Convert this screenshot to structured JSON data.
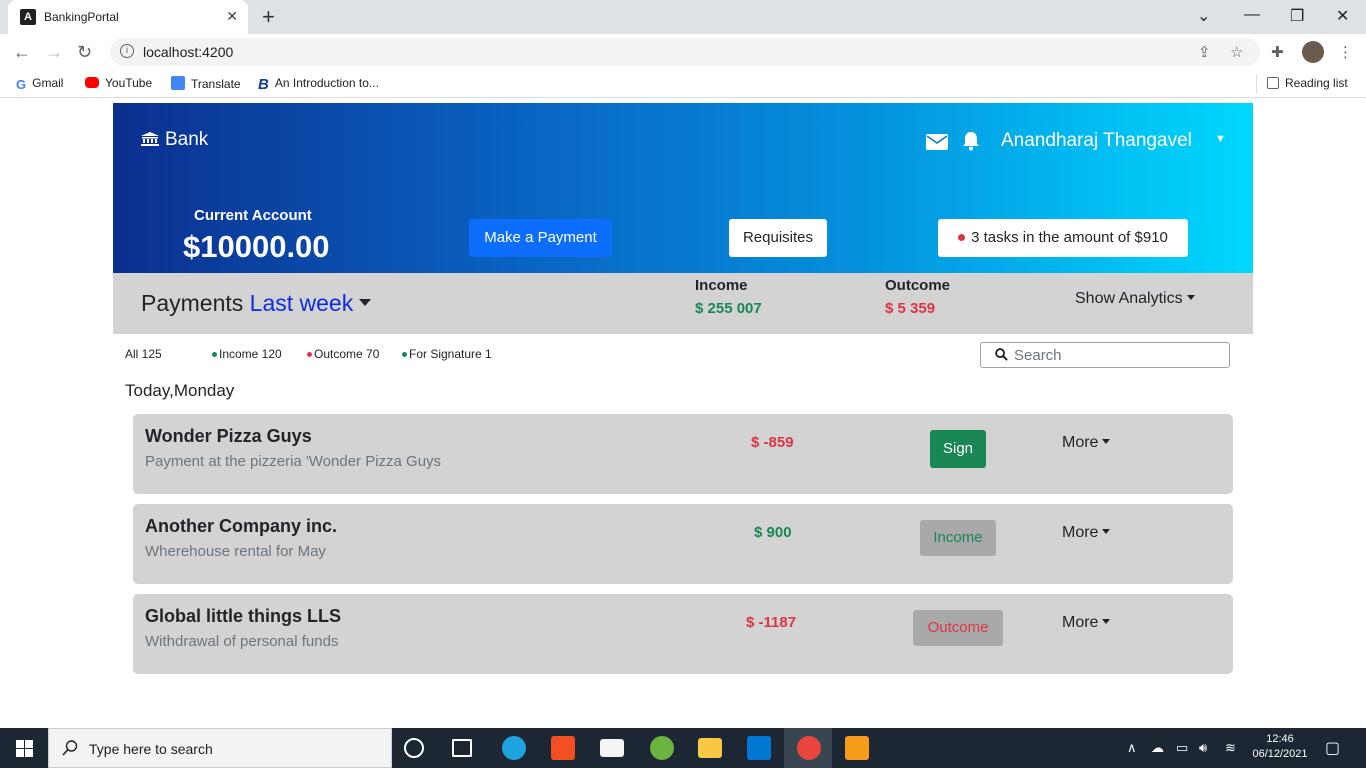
{
  "browser": {
    "tab_title": "BankingPortal",
    "tab_favicon": "A",
    "url": "localhost:4200",
    "bookmarks": [
      {
        "label": "Gmail",
        "color": "#ea4335"
      },
      {
        "label": "YouTube",
        "color": "#ff0000"
      },
      {
        "label": "Translate",
        "color": "#4285f4"
      },
      {
        "label": "An Introduction to...",
        "color": "#1a3d8f"
      }
    ],
    "reading_list": "Reading list"
  },
  "header": {
    "brand": "Bank",
    "user_name": "Anandharaj Thangavel",
    "account_label": "Current Account",
    "balance": "$10000.00",
    "make_payment": "Make a Payment",
    "requisites": "Requisites",
    "tasks": "3 tasks in the amount of $910"
  },
  "summary": {
    "title": "Payments",
    "period": "Last week",
    "income_label": "Income",
    "income_value": "$ 255 007",
    "outcome_label": "Outcome",
    "outcome_value": "$ 5 359",
    "analytics": "Show Analytics"
  },
  "filters": {
    "all": "All 125",
    "income": "Income 120",
    "outcome": "Outcome 70",
    "signature": "For Signature 1",
    "search_placeholder": "Search"
  },
  "day_heading": "Today,Monday",
  "transactions": [
    {
      "name": "Wonder Pizza Guys",
      "description": "Payment at the pizzeria 'Wonder Pizza Guys",
      "amount": "$ -859",
      "action": "Sign",
      "more": "More"
    },
    {
      "name": "Another Company inc.",
      "description": "Wherehouse rental for May",
      "amount": "$ 900",
      "action": "Income",
      "more": "More"
    },
    {
      "name": "Global little things LLS",
      "description": "Withdrawal of personal funds",
      "amount": "$ -1187",
      "action": "Outcome",
      "more": "More"
    }
  ],
  "taskbar": {
    "search_placeholder": "Type here to search",
    "time": "12:46",
    "date": "06/12/2021"
  },
  "colors": {
    "brand_gradient_start": "#0b2f8f",
    "brand_gradient_end": "#00d8ff",
    "primary": "#0d6efd",
    "success": "#198754",
    "danger": "#dc3545",
    "panel": "#d3d3d3"
  }
}
